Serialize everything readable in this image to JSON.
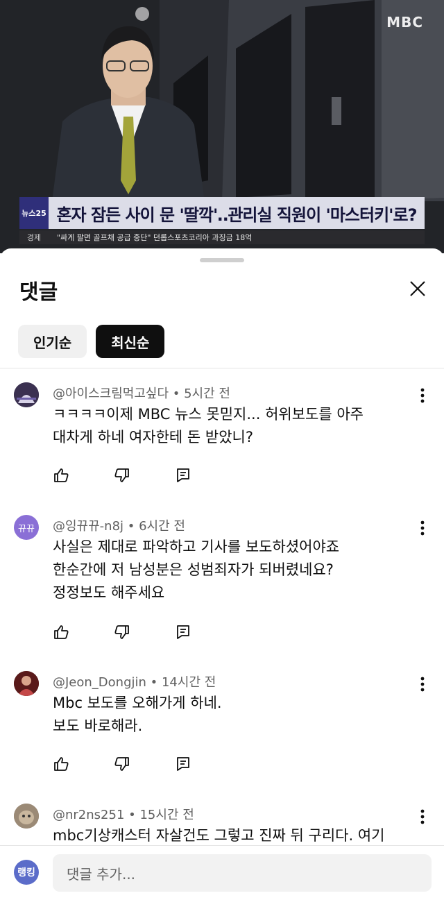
{
  "video": {
    "channel_logo": "MBC",
    "chyron_badge": "뉴스25",
    "headline": "혼자 잠든 사이 문 '딸깍'‥관리실 직원이 '마스터키'로?",
    "ticker_section": "경제",
    "ticker_text": "\"싸게 팔면 골프채 공급 중단\" 던롭스포츠코리아 과징금 18억"
  },
  "sheet": {
    "title": "댓글",
    "close_icon": "close-icon",
    "chips": [
      {
        "label": "인기순",
        "selected": false
      },
      {
        "label": "최신순",
        "selected": true
      }
    ]
  },
  "comments": [
    {
      "author": "@아이스크림먹고싶다",
      "time": "5시간 전",
      "avatar_text": "",
      "lines": [
        "ㅋㅋㅋㅋ이제 MBC 뉴스 못믿지... 허위보도를 아주",
        "대차게 하네 여자한테 돈 받았니?"
      ]
    },
    {
      "author": "@잉뀨뀨-n8j",
      "time": "6시간 전",
      "avatar_text": "뀨뀨",
      "lines": [
        "사실은 제대로 파악하고 기사를 보도하셨어야죠",
        "한순간에 저 남성분은 성범죄자가 되버렸네요?",
        "정정보도 해주세요"
      ]
    },
    {
      "author": "@Jeon_Dongjin",
      "time": "14시간 전",
      "avatar_text": "",
      "lines": [
        "Mbc 보도를 오해가게 하네.",
        "보도 바로해라."
      ]
    },
    {
      "author": "@nr2ns251",
      "time": "15시간 전",
      "avatar_text": "",
      "lines": [
        "mbc기상캐스터 자살건도 그렇고 진짜 뒤 구리다. 여기"
      ]
    }
  ],
  "footer": {
    "avatar_text": "랭킹",
    "placeholder": "댓글 추가..."
  },
  "colors": {
    "chyron_bg": "#dcdde8",
    "chyron_badge": "#2f2f7a",
    "avatar_purple": "#8a6fd6",
    "footer_avatar": "#5b6cc9"
  }
}
